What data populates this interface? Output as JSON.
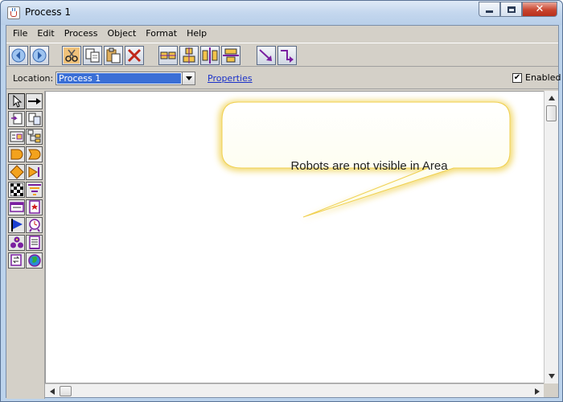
{
  "window": {
    "title": "Process 1",
    "close_glyph": "✕"
  },
  "menu": {
    "items": [
      "File",
      "Edit",
      "Process",
      "Object",
      "Format",
      "Help"
    ]
  },
  "toolbar": {
    "icons": [
      "back-arrow-icon",
      "forward-arrow-icon",
      "cut-icon",
      "copy-icon",
      "paste-icon",
      "delete-icon",
      "align-icon",
      "align-icon",
      "align-icon",
      "align-icon",
      "diagonal-connector-icon",
      "elbow-connector-icon"
    ]
  },
  "location": {
    "label": "Location:",
    "value": "Process 1",
    "properties_link": "Properties"
  },
  "enabled": {
    "label": "Enabled",
    "checked": true,
    "check_glyph": "✔"
  },
  "palette": {
    "icons": [
      "pointer-icon",
      "arrow-icon",
      "document-icon",
      "documents-icon",
      "module-icon",
      "tree-icon",
      "delay-shape-icon",
      "delay-outline-icon",
      "diamond-icon",
      "step-end-icon",
      "checkered-icon",
      "funnel-icon",
      "window-icon",
      "star-page-icon",
      "flag-icon",
      "clock-icon",
      "group-icon",
      "report-icon",
      "refresh-icon",
      "globe-icon"
    ]
  },
  "callout": {
    "text": "Robots are not visible in Area"
  },
  "colors": {
    "bubble_fill": "#fdfde6",
    "bubble_glow": "#f2d86a",
    "selection": "#3b6fd6",
    "link": "#1a31c9"
  }
}
